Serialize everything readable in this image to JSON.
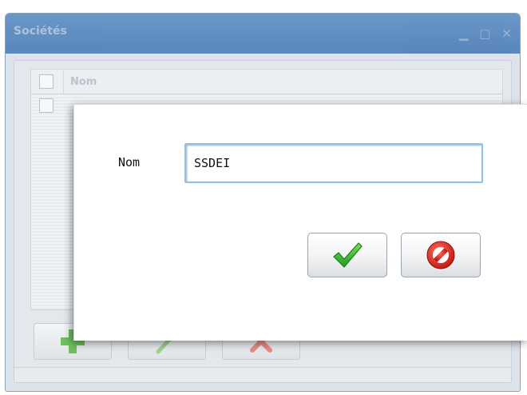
{
  "window": {
    "title": "Sociétés",
    "controls": [
      "minimize-icon",
      "maximize-icon",
      "close-icon"
    ]
  },
  "grid": {
    "column_header": "Nom",
    "rows": 1
  },
  "toolbar": {
    "buttons": [
      "add-icon",
      "edit-icon",
      "delete-icon"
    ]
  },
  "dialog": {
    "field_label": "Nom",
    "field_value": "SSDEI",
    "buttons": [
      "confirm-check-icon",
      "cancel-prohibited-icon"
    ]
  },
  "colors": {
    "title_bar": "#5e8fc6",
    "input_border": "#8ec2ec",
    "confirm_green": "#2ea82a",
    "cancel_red": "#d2231c"
  }
}
